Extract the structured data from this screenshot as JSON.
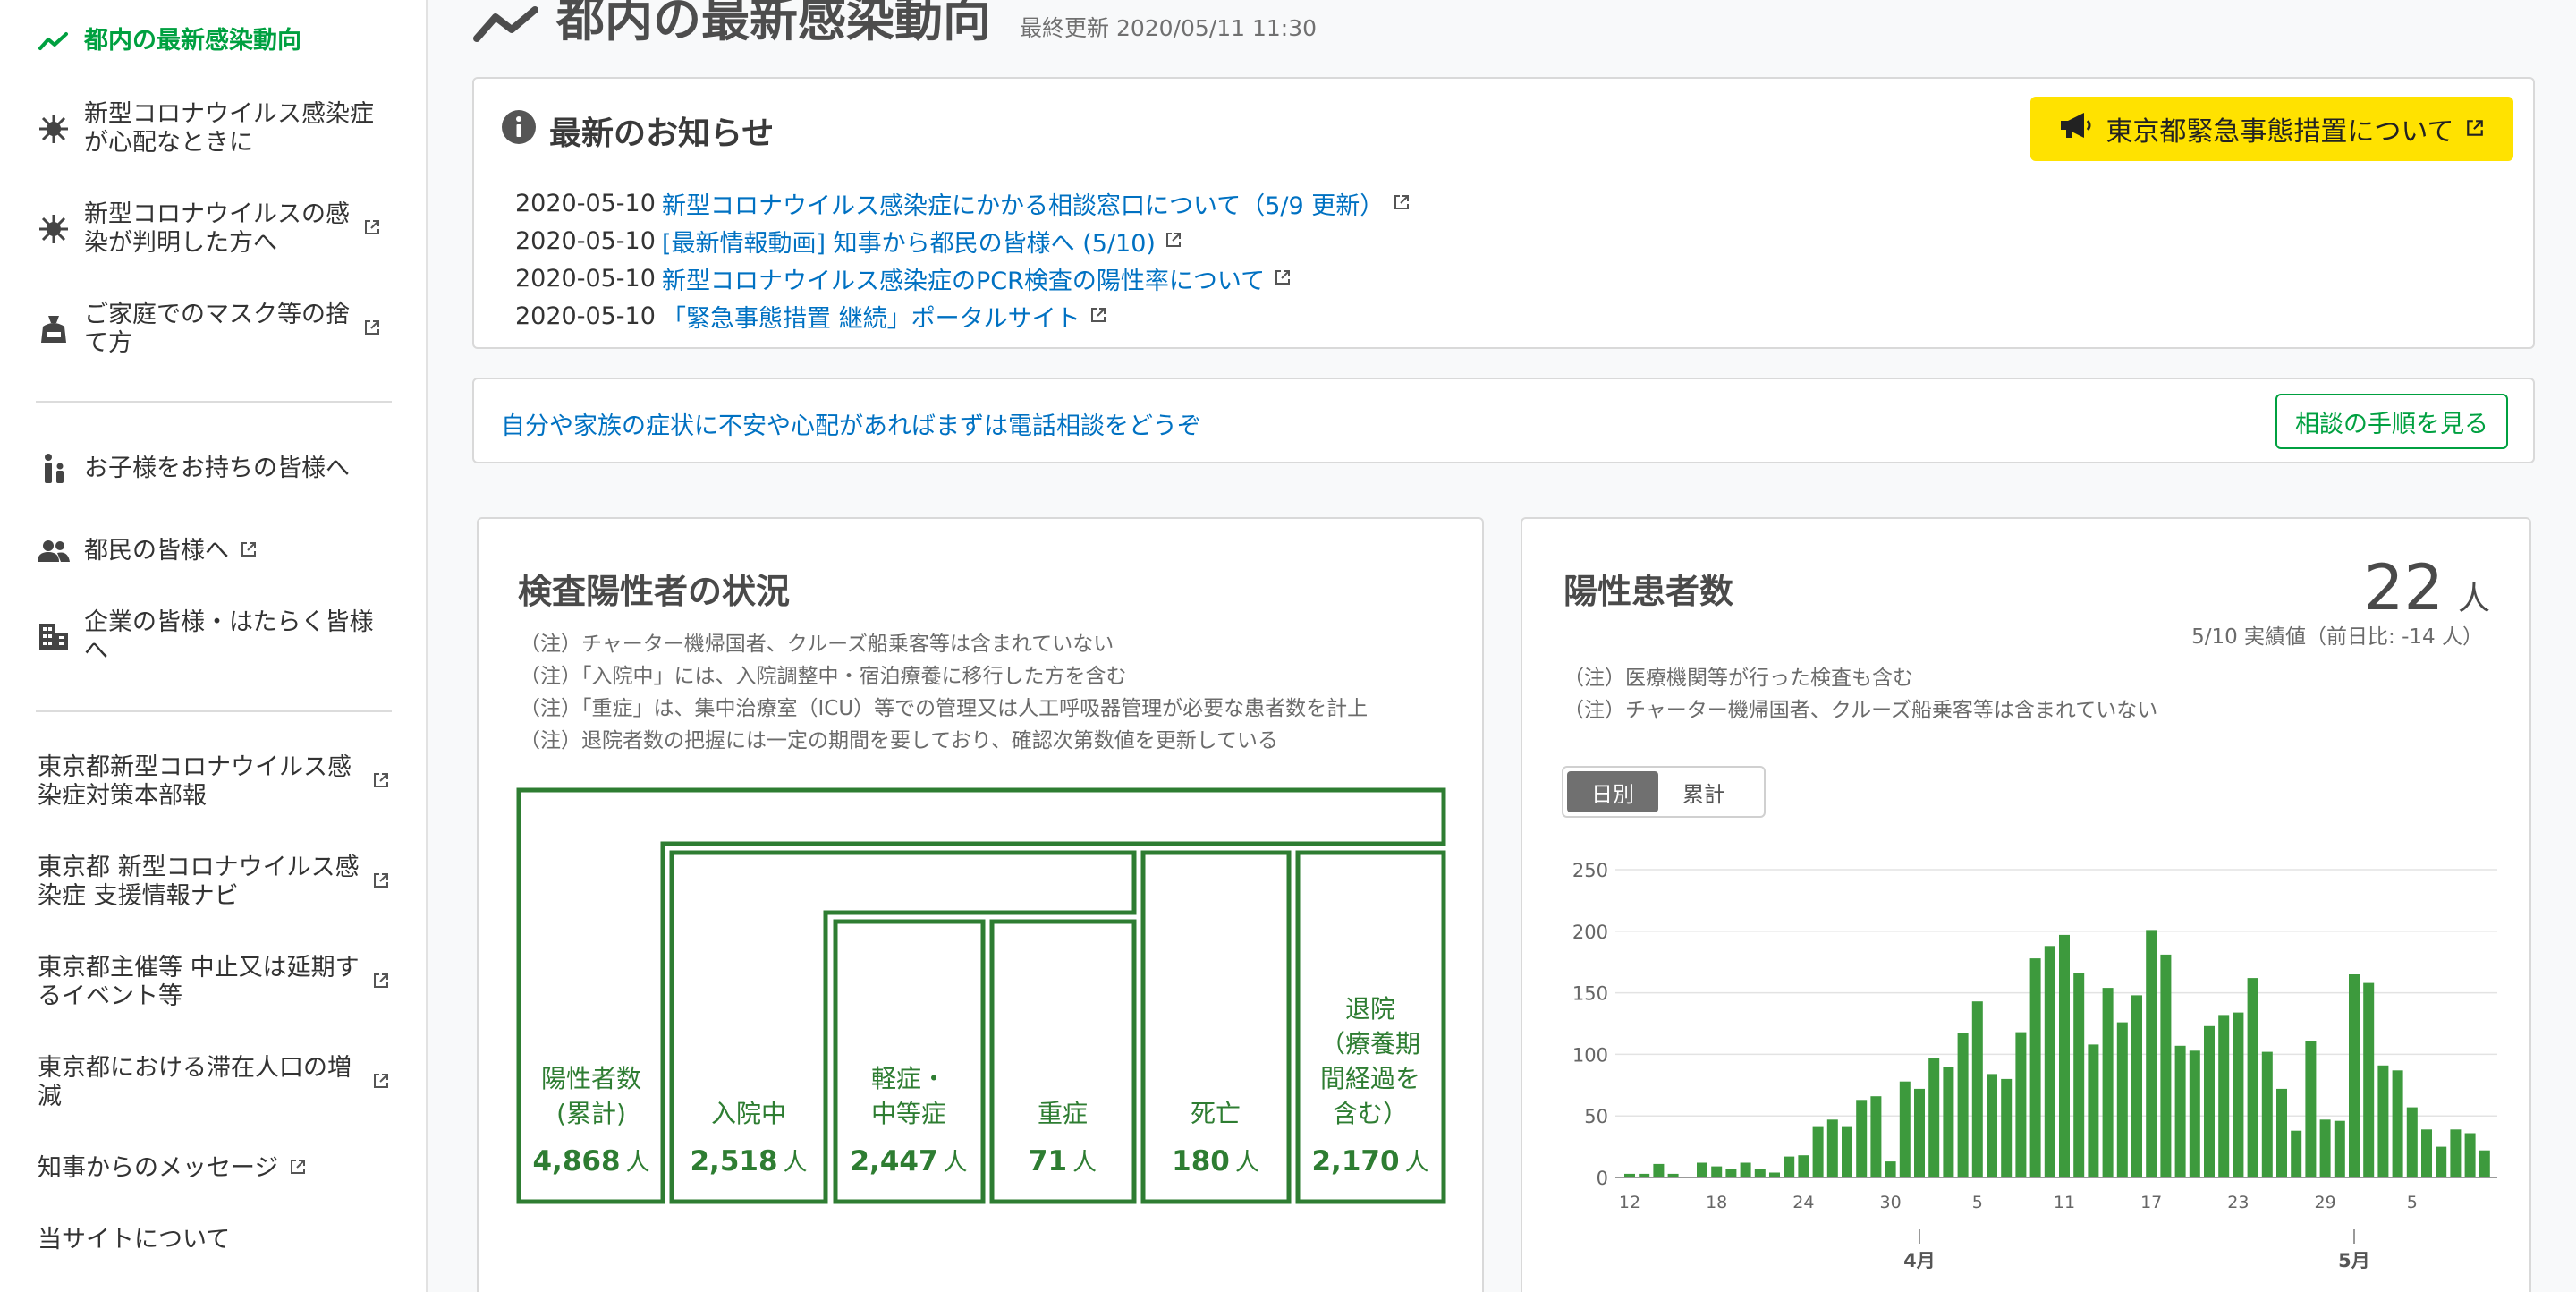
{
  "sidebar": {
    "items": [
      {
        "label": "都内の最新感染動向",
        "icon": "trend-icon",
        "external": false
      },
      {
        "label": "新型コロナウイルス感染症が心配なときに",
        "icon": "virus-icon",
        "external": false
      },
      {
        "label": "新型コロナウイルスの感染が判明した方へ",
        "icon": "virus-icon",
        "external": true
      },
      {
        "label": "ご家庭でのマスク等の捨て方",
        "icon": "trash-bag-icon",
        "external": true
      },
      {
        "label": "お子様をお持ちの皆様へ",
        "icon": "parent-child-icon",
        "external": false
      },
      {
        "label": "都民の皆様へ",
        "icon": "people-icon",
        "external": true
      },
      {
        "label": "企業の皆様・はたらく皆様へ",
        "icon": "building-icon",
        "external": false
      },
      {
        "label": "東京都新型コロナウイルス感染症対策本部報",
        "external": true
      },
      {
        "label": "東京都 新型コロナウイルス感染症 支援情報ナビ",
        "external": true
      },
      {
        "label": "東京都主催等 中止又は延期するイベント等",
        "external": true
      },
      {
        "label": "東京都における滞在人口の増減",
        "external": true
      },
      {
        "label": "知事からのメッセージ",
        "external": true
      },
      {
        "label": "当サイトについて",
        "external": false
      }
    ],
    "accent_color": "#00a040"
  },
  "header": {
    "title": "都内の最新感染動向",
    "last_updated": "最終更新 2020/05/11 11:30"
  },
  "notices": {
    "heading": "最新のお知らせ",
    "emergency_button": "東京都緊急事態措置について",
    "items": [
      {
        "date": "2020-05-10",
        "text": "新型コロナウイルス感染症にかかる相談窓口について（5/9 更新）"
      },
      {
        "date": "2020-05-10",
        "text": "[最新情報動画] 知事から都民の皆様へ (5/10)"
      },
      {
        "date": "2020-05-10",
        "text": "新型コロナウイルス感染症のPCR検査の陽性率について"
      },
      {
        "date": "2020-05-10",
        "text": "「緊急事態措置 継続」ポータルサイト"
      }
    ]
  },
  "consult": {
    "text": "自分や家族の症状に不安や心配があればまずは電話相談をどうぞ",
    "button": "相談の手順を見る"
  },
  "status": {
    "title": "検査陽性者の状況",
    "notes": [
      "（注）チャーター機帰国者、クルーズ船乗客等は含まれていない",
      "（注）「入院中」には、入院調整中・宿泊療養に移行した方を含む",
      "（注）「重症」は、集中治療室（ICU）等での管理又は人工呼吸器管理が必要な患者数を計上",
      "（注）退院者数の把握には一定の期間を要しており、確認次第数値を更新している"
    ],
    "boxes": {
      "positive": {
        "label": "陽性者数\n(累計)",
        "value": "4,868",
        "unit": "人"
      },
      "hospitalized": {
        "label": "入院中",
        "value": "2,518",
        "unit": "人"
      },
      "mild": {
        "label": "軽症・\n中等症",
        "value": "2,447",
        "unit": "人"
      },
      "severe": {
        "label": "重症",
        "value": "71",
        "unit": "人"
      },
      "deceased": {
        "label": "死亡",
        "value": "180",
        "unit": "人"
      },
      "discharged": {
        "label": "退院\n（療養期\n間経過を\n含む）",
        "value": "2,170",
        "unit": "人"
      }
    },
    "color": "#2e7d32"
  },
  "positive": {
    "title": "陽性患者数",
    "value": "22",
    "unit": "人",
    "sub": "5/10 実績値（前日比: -14 人）",
    "notes": [
      "（注）医療機関等が行った検査も含む",
      "（注）チャーター機帰国者、クルーズ船乗客等は含まれていない"
    ],
    "toggle": {
      "daily": "日別",
      "cumulative": "累計"
    },
    "bar_color": "#3d9a3d"
  },
  "chart_data": {
    "type": "bar",
    "ylim": [
      0,
      250
    ],
    "yticks": [
      0,
      50,
      100,
      150,
      200,
      250
    ],
    "xtick_labels": [
      "12",
      "18",
      "24",
      "30",
      "5",
      "11",
      "17",
      "23",
      "29",
      "5"
    ],
    "month_labels": [
      "4月",
      "5月"
    ],
    "values": [
      3,
      3,
      11,
      3,
      0,
      12,
      9,
      7,
      12,
      7,
      4,
      17,
      18,
      41,
      47,
      41,
      63,
      66,
      13,
      78,
      72,
      97,
      90,
      117,
      143,
      84,
      80,
      118,
      178,
      188,
      197,
      166,
      108,
      154,
      126,
      148,
      201,
      181,
      107,
      103,
      123,
      132,
      134,
      162,
      102,
      72,
      38,
      111,
      47,
      46,
      165,
      158,
      91,
      87,
      57,
      39,
      25,
      39,
      36,
      22
    ],
    "grid": true
  }
}
